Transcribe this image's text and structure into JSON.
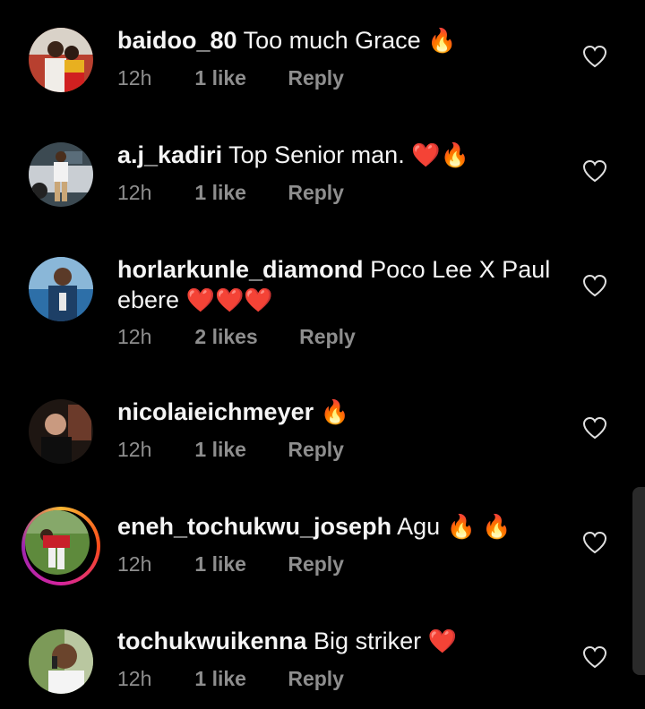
{
  "comments": [
    {
      "username": "baidoo_80",
      "text": "Too much Grace",
      "emojis": "🔥",
      "time": "12h",
      "likes": "1 like",
      "reply": "Reply"
    },
    {
      "username": "a.j_kadiri",
      "text": "Top Senior man.",
      "emojis": "❤️🔥",
      "time": "12h",
      "likes": "1 like",
      "reply": "Reply"
    },
    {
      "username": "horlarkunle_diamond",
      "text": "Poco Lee X Paul",
      "text2": "ebere",
      "emojis": "❤️❤️❤️",
      "time": "12h",
      "likes": "2 likes",
      "reply": "Reply"
    },
    {
      "username": "nicolaieichmeyer",
      "text": "",
      "emojis": "🔥",
      "time": "12h",
      "likes": "1 like",
      "reply": "Reply"
    },
    {
      "username": "eneh_tochukwu_joseph",
      "text": "Agu",
      "emojis": "🔥 🔥",
      "time": "12h",
      "likes": "1 like",
      "reply": "Reply"
    },
    {
      "username": "tochukwuikenna",
      "text": "Big striker",
      "emojis": "❤️",
      "time": "12h",
      "likes": "1 like",
      "reply": "Reply"
    }
  ],
  "icons": {
    "like": "heart-outline-icon"
  },
  "colors": {
    "background": "#000000",
    "text": "#f5f5f5",
    "meta": "#8e8e8e",
    "heart": "#e8112d"
  }
}
